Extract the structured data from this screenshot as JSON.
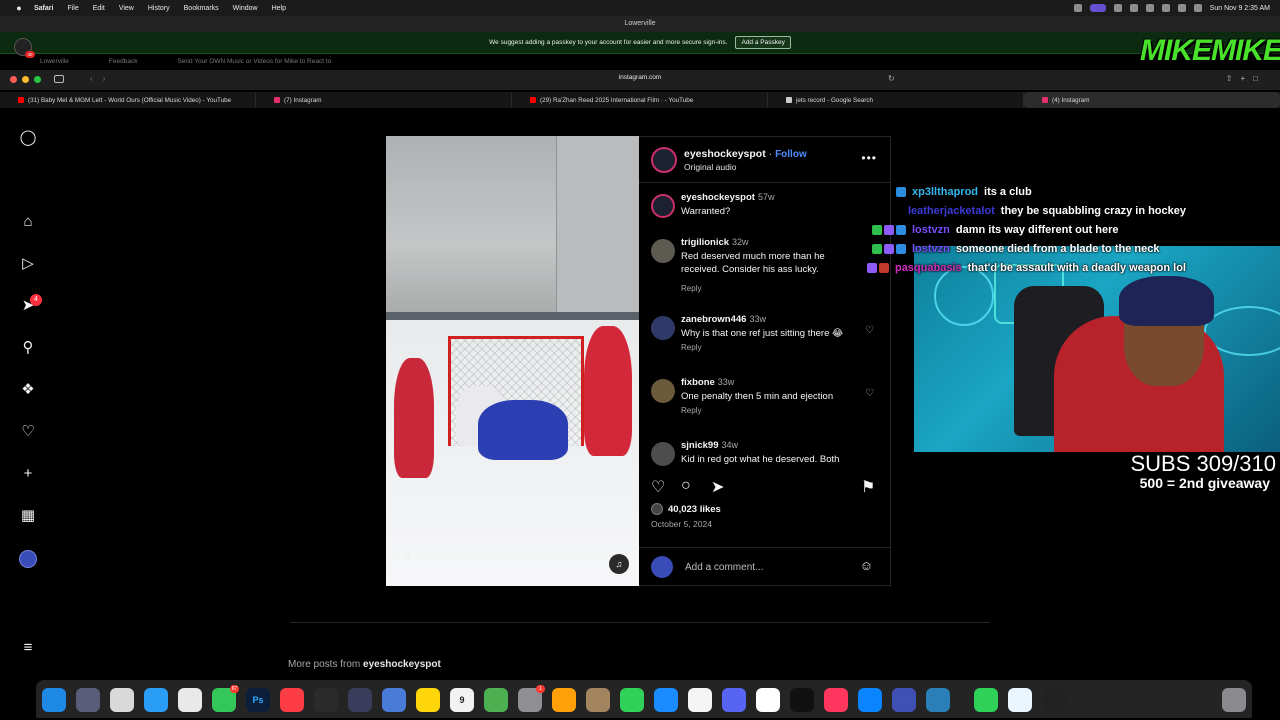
{
  "menubar": {
    "app": "Safari",
    "items": [
      "File",
      "Edit",
      "View",
      "History",
      "Bookmarks",
      "Window",
      "Help"
    ],
    "clock": "Sun Nov 9  2:35 AM"
  },
  "window": {
    "title": "Lowerville"
  },
  "banner": {
    "text": "We suggest adding a passkey to your account for easier and more secure sign-ins.",
    "button": "Add a Passkey",
    "avatar_badge": "40"
  },
  "ghost_tabs": [
    "Lowerville",
    "Feedback",
    "Send Your OWN Music or Videos for Mike to React to"
  ],
  "toolbar": {
    "address": "instagram.com"
  },
  "tabs": [
    {
      "label": "(31) Baby Mel & MGM Lett - World Ours (Official Music Video) - YouTube",
      "color": "#ff0000"
    },
    {
      "label": "(7) Instagram",
      "color": "#e1306c"
    },
    {
      "label": "(29) Ra'Zhan Reed 2025 International Film · - YouTube",
      "color": "#ff0000"
    },
    {
      "label": "jets record - Google Search",
      "color": "#cccccc"
    },
    {
      "label": "(4) Instagram",
      "color": "#e1306c",
      "active": true
    }
  ],
  "sidebar": {
    "notif_count": "4"
  },
  "post": {
    "username": "eyeshockeyspot",
    "follow": "Follow",
    "audio": "Original audio",
    "comments": [
      {
        "user": "eyeshockeyspot",
        "age": "57w",
        "text": "Warranted?",
        "reply": ""
      },
      {
        "user": "trigilionick",
        "age": "32w",
        "text": "Red deserved much more than he received. Consider his ass lucky.",
        "reply": "Reply"
      },
      {
        "user": "zanebrown446",
        "age": "33w",
        "text": "Why is that one ref just sitting there 😂",
        "reply": "Reply"
      },
      {
        "user": "fixbone",
        "age": "33w",
        "text": "One penalty then 5 min and ejection",
        "reply": "Reply"
      },
      {
        "user": "sjnick99",
        "age": "34w",
        "text": "Kid in red got what he deserved. Both",
        "reply": ""
      }
    ],
    "likes": "40,023 likes",
    "date": "October 5, 2024",
    "add_comment": "Add a comment..."
  },
  "more_posts": {
    "prefix": "More posts from ",
    "user": "eyeshockeyspot"
  },
  "chat": [
    {
      "name": "xp3llthaprod",
      "color": "#35b7f0",
      "message": "its a club"
    },
    {
      "name": "leatherjacketalot",
      "color": "#3b3bd8",
      "message": "they be squabbling crazy in hockey"
    },
    {
      "name": "lostvzn",
      "color": "#7a4dff",
      "message": "damn its way different out here"
    },
    {
      "name": "lostvzn",
      "color": "#7a4dff",
      "message": "someone died from a blade to the neck"
    },
    {
      "name": "pasquabasis",
      "color": "#d02fbf",
      "message": "that'd be assault with a deadly weapon lol"
    }
  ],
  "overlay": {
    "logo": "MIKEMIKE",
    "subs": "SUBS 309/310",
    "giveaway": "500 = 2nd giveaway"
  },
  "dock": {
    "calendar_day": "9",
    "messages_badge": "67",
    "mail_badge": "1"
  }
}
